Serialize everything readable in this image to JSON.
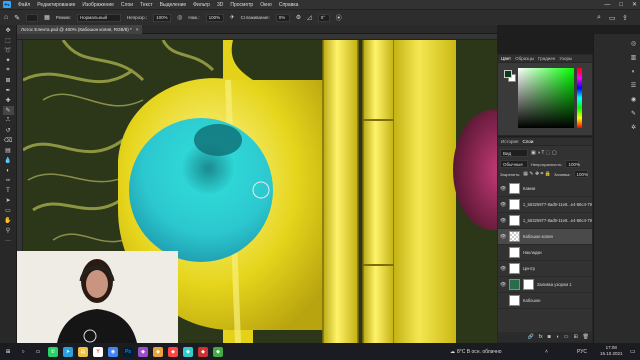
{
  "menubar": {
    "app_logo": "Ps",
    "items": [
      "Файл",
      "Редактирование",
      "Изображение",
      "Слои",
      "Текст",
      "Выделение",
      "Фильтр",
      "3D",
      "Просмотр",
      "Окно",
      "Справка"
    ],
    "window_controls": [
      "—",
      "□",
      "✕"
    ]
  },
  "options": {
    "mode_label": "Режим:",
    "mode_value": "Нормальный",
    "opacity_label": "Непрозр.:",
    "opacity_value": "100%",
    "flow_label": "Наж.:",
    "flow_value": "100%",
    "smoothing_label": "Сглаживание:",
    "smoothing_value": "0%",
    "angle_value": "0°"
  },
  "document": {
    "tab_title": "Лотос Елента.psd @ 400% (Кабошон копия, RGB/8) *",
    "close": "×"
  },
  "color_panel": {
    "tabs": [
      "Цвет",
      "Образцы",
      "Градиен",
      "Узоры"
    ],
    "active_tab": "Цвет",
    "fg_color": "#0a3a18",
    "bg_color": "#ffffff"
  },
  "layers_panel": {
    "tabs": [
      "История",
      "Слои"
    ],
    "active_tab": "Слои",
    "kind_placeholder": "Вид",
    "blend_mode": "Обычные",
    "opacity_label": "Непрозрачность:",
    "opacity_value": "100%",
    "lock_label": "Закрепить:",
    "fill_label": "Заливка:",
    "fill_value": "100%",
    "layers": [
      {
        "name": "Камни",
        "visible": true,
        "selected": false,
        "thumb": "white"
      },
      {
        "name": "1_56325977-8ad9-11e8...e4-86c4-79c3b519dd7",
        "visible": true,
        "selected": false,
        "thumb": "white"
      },
      {
        "name": "1_56325977-8ad9-11e8...e4-86c4-79c3b519dd7",
        "visible": true,
        "selected": false,
        "thumb": "white"
      },
      {
        "name": "Кабошон копия",
        "visible": true,
        "selected": true,
        "thumb": "checker"
      },
      {
        "name": "Накладки",
        "visible": false,
        "selected": false,
        "thumb": "white"
      },
      {
        "name": "Центр",
        "visible": true,
        "selected": false,
        "thumb": "white"
      },
      {
        "name": "Заливка узором 1",
        "visible": true,
        "selected": false,
        "thumb": "pattern"
      },
      {
        "name": "Кабошон",
        "visible": false,
        "selected": false,
        "thumb": "white"
      }
    ]
  },
  "taskbar": {
    "weather": "8°C В осн. облачно",
    "lang": "РУС",
    "time": "17:08",
    "date": "15.10.2021"
  }
}
